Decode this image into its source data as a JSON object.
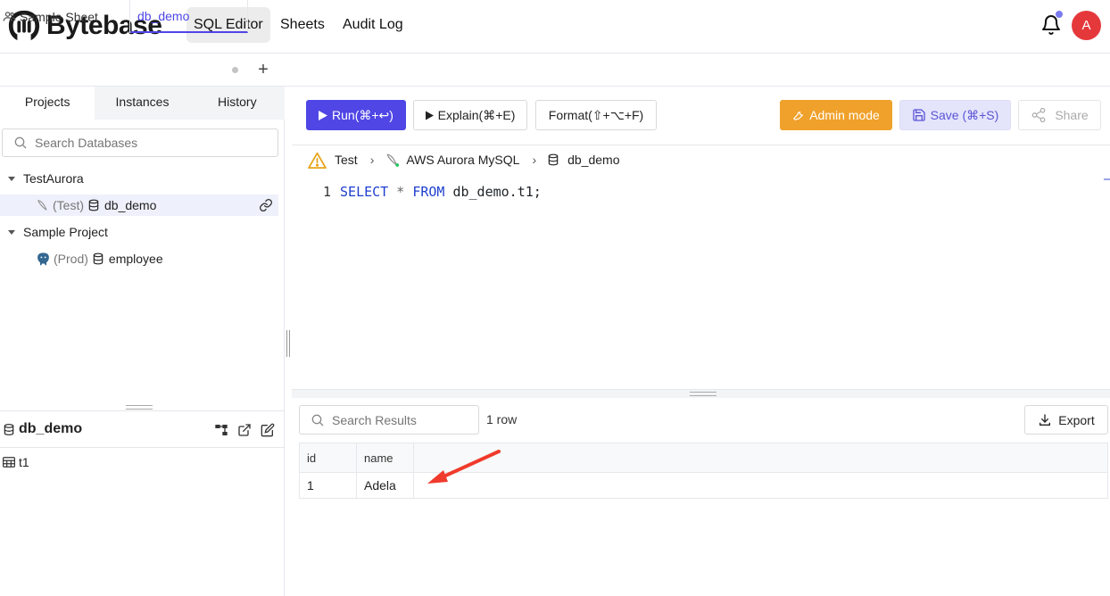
{
  "app": {
    "name": "Bytebase",
    "nav": [
      "SQL Editor",
      "Sheets",
      "Audit Log"
    ],
    "active_nav": "SQL Editor",
    "user_initial": "A",
    "colors": {
      "primary": "#4f46e5",
      "admin": "#f0a12b",
      "avatar": "#e5383b"
    }
  },
  "tabs": {
    "sample": "Sample Sheet",
    "active": "db_demo",
    "add_label": "+"
  },
  "sidebar": {
    "tabs": [
      "Projects",
      "Instances",
      "History"
    ],
    "active_tab": "Projects",
    "search_placeholder": "Search Databases",
    "tree": [
      {
        "project": "TestAurora",
        "env": "(Test)",
        "database": "db_demo",
        "icon": "aurora-icon",
        "selected": true
      },
      {
        "project": "Sample Project",
        "env": "(Prod)",
        "database": "employee",
        "icon": "postgres-icon",
        "selected": false
      }
    ]
  },
  "schema": {
    "database": "db_demo",
    "tables": [
      "t1"
    ]
  },
  "toolbar": {
    "run": "Run(⌘+↩)",
    "explain": "Explain(⌘+E)",
    "format": "Format(⇧+⌥+F)",
    "admin": "Admin mode",
    "save": "Save (⌘+S)",
    "share": "Share"
  },
  "breadcrumb": {
    "environment": "Test",
    "instance": "AWS Aurora MySQL",
    "database": "db_demo"
  },
  "editor": {
    "line_number": "1",
    "tokens": [
      "SELECT",
      " ",
      "*",
      " ",
      "FROM",
      " ",
      "db_demo.t1;"
    ]
  },
  "results": {
    "search_placeholder": "Search Results",
    "row_count": "1 row",
    "export": "Export",
    "columns": [
      "id",
      "name"
    ],
    "rows": [
      [
        "1",
        "Adela"
      ]
    ]
  }
}
